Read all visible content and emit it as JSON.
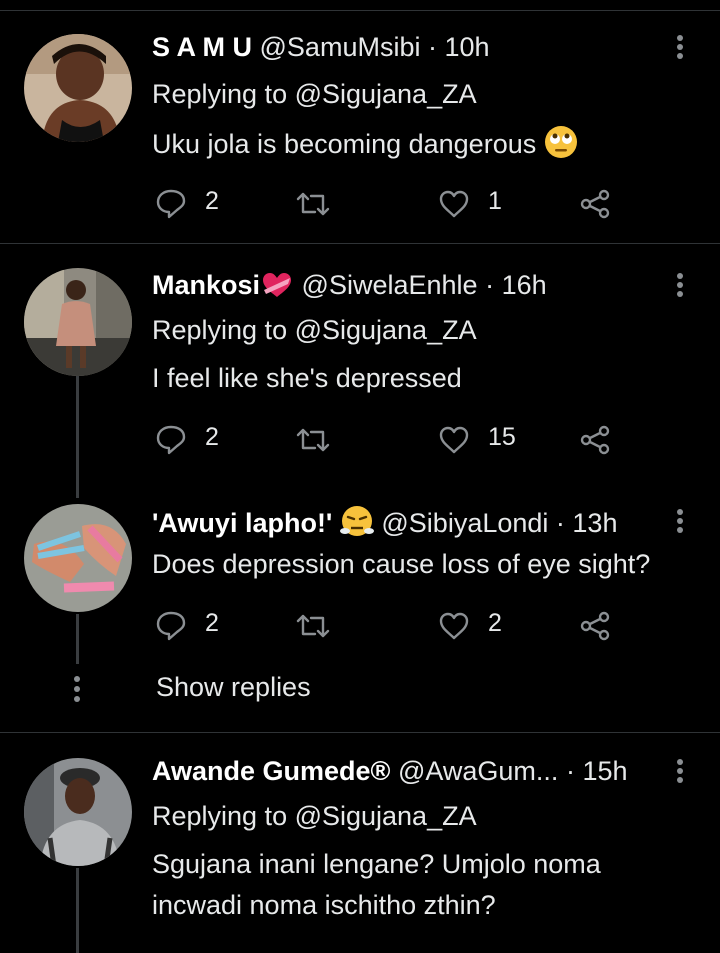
{
  "tweets": [
    {
      "name": "S A M U",
      "handle": "@SamuMsibi",
      "time": "· 10h",
      "replying": "Replying to @Sigujana_ZA",
      "text": "Uku jola is becoming dangerous",
      "emoji": "rolling-eyes",
      "replies": "2",
      "likes": "1"
    },
    {
      "name": "Mankosi",
      "handle": "@SiwelaEnhle",
      "time": "· 16h",
      "replying": "Replying to @Sigujana_ZA",
      "text": "I feel like she's depressed",
      "emoji": "heart-with-ribbon",
      "replies": "2",
      "likes": "15"
    },
    {
      "name": "'Awuyi lapho!'",
      "handle": "@SibiyaLondi",
      "time": "· 13h",
      "text": "Does depression cause loss of eye sight?",
      "emoji": "face-with-steam",
      "replies": "2",
      "likes": "2"
    },
    {
      "name": "Awande Gumede®",
      "handle": "@AwaGum...",
      "time": "· 15h",
      "replying": "Replying to @Sigujana_ZA",
      "text_line1": "Sgujana inani lengane? Umjolo noma",
      "text_line2": "incwadi noma ischitho zthin?"
    }
  ],
  "show_replies": "Show replies",
  "colors": {
    "background": "#000000",
    "text": "#e7e9ea",
    "divider": "#2f3336",
    "icon": "#8b8f93"
  }
}
